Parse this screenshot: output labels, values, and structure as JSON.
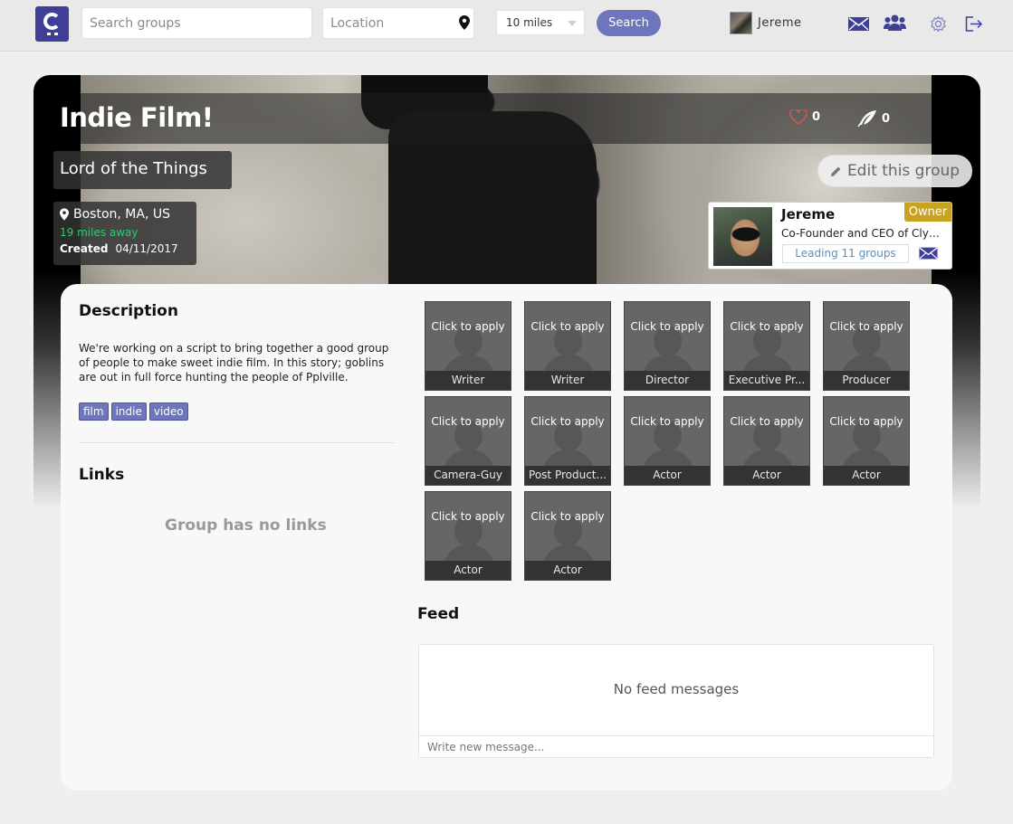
{
  "navbar": {
    "search_placeholder": "Search groups",
    "location_placeholder": "Location",
    "distance": "10 miles",
    "search_label": "Search",
    "user_name": "Jereme",
    "icons": [
      "envelope-icon",
      "groups-icon",
      "gear-icon",
      "logout-icon"
    ],
    "brand_color": "#3f3f99"
  },
  "group": {
    "title": "Indie Film!",
    "likes": "0",
    "posts": "0",
    "subtitle": "Lord of the Things",
    "location": "Boston, MA, US",
    "distance": "19 miles away",
    "created_label": "Created",
    "created_date": "04/11/2017",
    "edit_label": "Edit this group"
  },
  "owner": {
    "name": "Jereme",
    "badge": "Owner",
    "role": "Co-Founder and CEO of Clyqu...",
    "leading": "Leading 11 groups"
  },
  "description": {
    "heading": "Description",
    "text": "We're working on a script to bring together a good group of people to make sweet indie film. In this story; goblins are out in full force hunting the people of Pplville.",
    "tags": [
      "film",
      "indie",
      "video"
    ]
  },
  "links": {
    "heading": "Links",
    "empty": "Group has no links"
  },
  "roles": {
    "apply_label": "Click to apply",
    "items": [
      "Writer",
      "Writer",
      "Director",
      "Executive Pr...",
      "Producer",
      "Camera-Guy",
      "Post Product...",
      "Actor",
      "Actor",
      "Actor",
      "Actor",
      "Actor"
    ]
  },
  "feed": {
    "heading": "Feed",
    "empty": "No feed messages",
    "input_placeholder": "Write new message..."
  },
  "colors": {
    "accent": "#6d75bd",
    "owner_badge": "#c7a31f",
    "distance_text": "#2ecc71",
    "like_heart": "#d9534f"
  }
}
